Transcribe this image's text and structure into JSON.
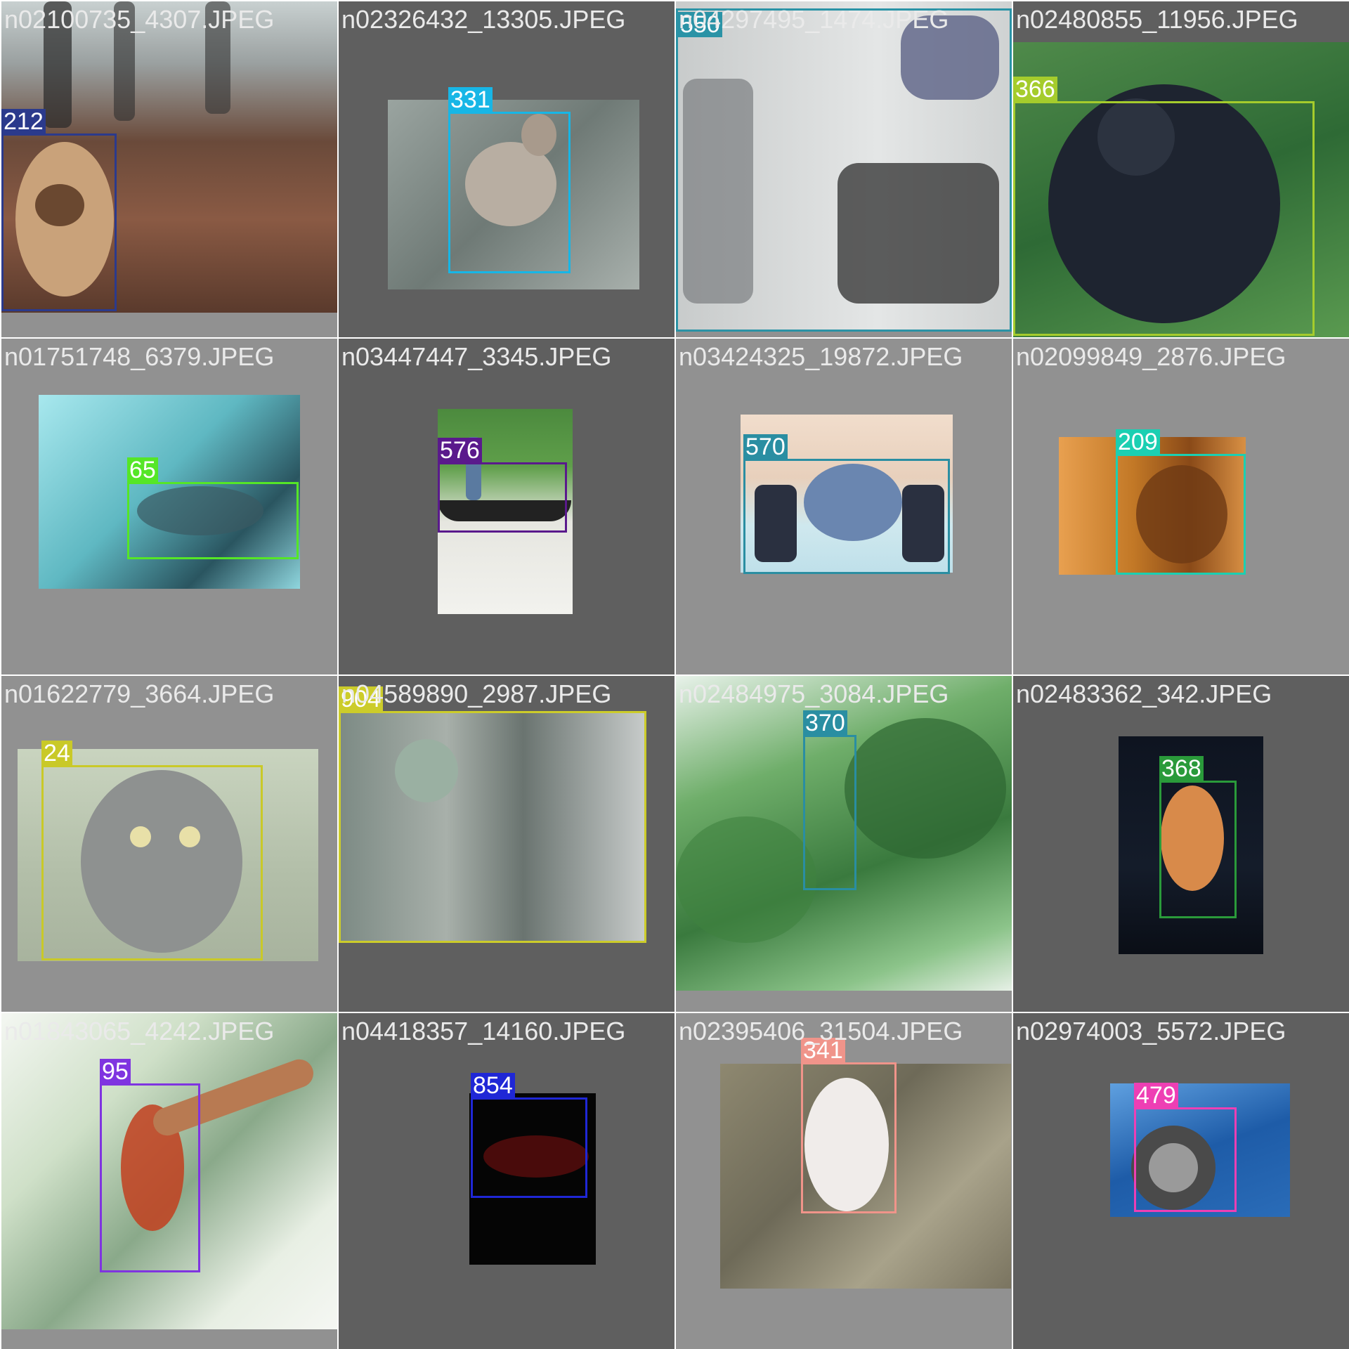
{
  "tiles": [
    {
      "filename": "n02100735_4307.JPEG",
      "label": "212",
      "color": "#2b3a8c",
      "tone": "light"
    },
    {
      "filename": "n02326432_13305.JPEG",
      "label": "331",
      "color": "#17b6e6",
      "tone": "dark"
    },
    {
      "filename": "n04297495_1474.JPEG",
      "label": "550",
      "color": "#2a93a6",
      "tone": "light"
    },
    {
      "filename": "n02480855_11956.JPEG",
      "label": "366",
      "color": "#a5cc2c",
      "tone": "dark"
    },
    {
      "filename": "n01751748_6379.JPEG",
      "label": "65",
      "color": "#55e627",
      "tone": "light"
    },
    {
      "filename": "n03447447_3345.JPEG",
      "label": "576",
      "color": "#5a1a8c",
      "tone": "dark"
    },
    {
      "filename": "n03424325_19872.JPEG",
      "label": "570",
      "color": "#2a8ea2",
      "tone": "light"
    },
    {
      "filename": "n02099849_2876.JPEG",
      "label": "209",
      "color": "#1bcfb2",
      "tone": "light"
    },
    {
      "filename": "n01622779_3664.JPEG",
      "label": "24",
      "color": "#c9c928",
      "tone": "light"
    },
    {
      "filename": "n04589890_2987.JPEG",
      "label": "904",
      "color": "#cccc2a",
      "tone": "dark"
    },
    {
      "filename": "n02484975_3084.JPEG",
      "label": "370",
      "color": "#2a8ea2",
      "tone": "light"
    },
    {
      "filename": "n02483362_342.JPEG",
      "label": "368",
      "color": "#2a9a3a",
      "tone": "dark"
    },
    {
      "filename": "n01843065_4242.JPEG",
      "label": "95",
      "color": "#7f34e0",
      "tone": "light"
    },
    {
      "filename": "n04418357_14160.JPEG",
      "label": "854",
      "color": "#1f27d6",
      "tone": "dark"
    },
    {
      "filename": "n02395406_31504.JPEG",
      "label": "341",
      "color": "#f0948a",
      "tone": "light"
    },
    {
      "filename": "n02974003_5572.JPEG",
      "label": "479",
      "color": "#ee3fb4",
      "tone": "dark"
    }
  ]
}
